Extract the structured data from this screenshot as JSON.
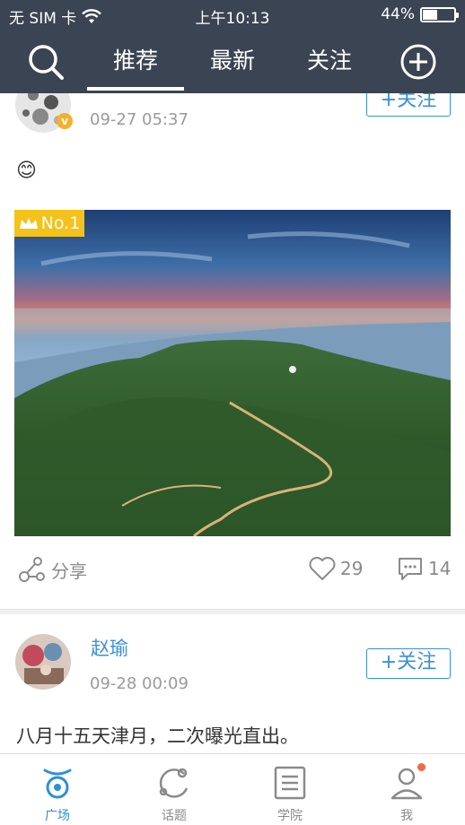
{
  "status_bar": {
    "carrier": "无 SIM 卡",
    "time": "上午10:13",
    "battery": "44%",
    "battery_level": 0.44
  },
  "top_nav": {
    "tabs": [
      "推荐",
      "最新",
      "关注"
    ],
    "active_tab": 0
  },
  "posts": [
    {
      "time": "09-27 05:37",
      "follow": "+关注",
      "verified_badge": "v",
      "emoji": "😊",
      "rank_badge": "No.1",
      "share": "分享",
      "likes": "29",
      "comments": "14"
    },
    {
      "username": "赵瑜",
      "time": "09-28 00:09",
      "follow": "+关注",
      "text": "八月十五天津月，二次曝光直出。"
    }
  ],
  "bottom_nav": {
    "items": [
      {
        "label": "广场",
        "icon": "square-icon"
      },
      {
        "label": "话题",
        "icon": "topic-icon"
      },
      {
        "label": "学院",
        "icon": "academy-icon"
      },
      {
        "label": "我",
        "icon": "profile-icon"
      }
    ],
    "active": 0,
    "accent": "#2d8fd8"
  },
  "colors": {
    "header": "#3a4452",
    "link": "#3a8fd9",
    "rank_badge": "#f5c21b",
    "notification_dot": "#f0674a"
  }
}
